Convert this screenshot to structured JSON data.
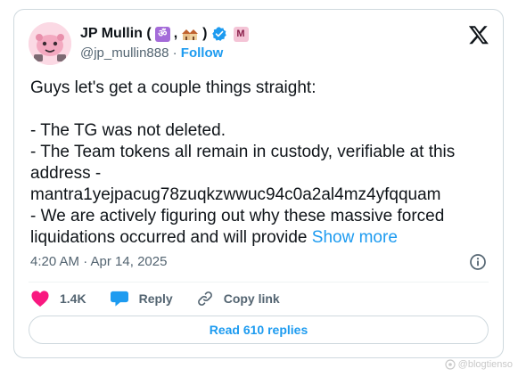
{
  "author": {
    "display_name": "JP Mullin (",
    "name_sep": ",",
    "name_close": ")",
    "handle": "@jp_mullin888",
    "separator": "·",
    "follow_label": "Follow"
  },
  "icons": {
    "avatar": "cartoon-avatar",
    "om_emoji": "om-symbol-emoji",
    "house_emoji": "houses-emoji",
    "verified": "verified-badge-icon",
    "affiliate": "affiliate-m-badge",
    "brand": "x-logo-icon",
    "info": "info-icon",
    "like": "heart-icon",
    "reply": "speech-bubble-icon",
    "copy": "link-icon"
  },
  "tweet": {
    "lines": [
      "Guys let's get a couple things straight:",
      "",
      "- The TG was not deleted.",
      "- The Team tokens all remain in custody, verifiable at this",
      "address -",
      "mantra1yejpacug78zuqkzwwuc94c0a2al4mz4yfqquam",
      "- We are actively figuring out why these massive forced",
      "liquidations occurred and will provide "
    ],
    "show_more": "Show more"
  },
  "meta": {
    "timestamp": "4:20 AM · Apr 14, 2025"
  },
  "actions": {
    "likes": "1.4K",
    "reply": "Reply",
    "copy_link": "Copy link"
  },
  "read_replies": "Read 610 replies",
  "watermark": "@blogtienso",
  "colors": {
    "accent": "#1d9bf0",
    "like": "#f91880",
    "reply": "#1d9bf0",
    "text": "#0f1419",
    "muted": "#536471",
    "border": "#cfd9de"
  }
}
